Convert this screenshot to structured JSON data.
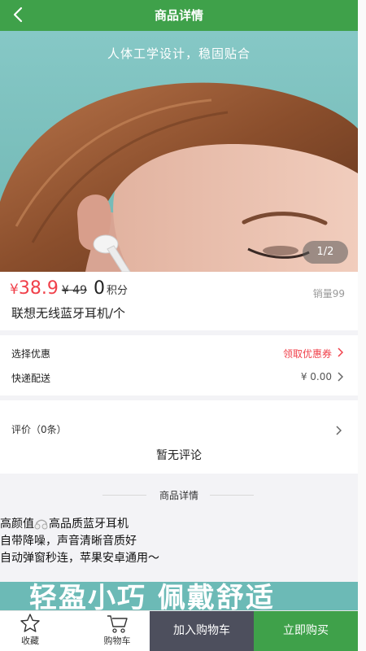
{
  "header": {
    "title": "商品详情",
    "back_icon": "chevron-left-icon"
  },
  "hero": {
    "tagline": "人体工学设计，稳固贴合",
    "pager": "1/2"
  },
  "product": {
    "currency": "¥",
    "price": "38.9",
    "old_price": "¥ 49",
    "points": "0",
    "points_unit": "积分",
    "sales_label": "销量",
    "sales_count": "99",
    "name": "联想无线蓝牙耳机/个"
  },
  "options": {
    "discount": {
      "label": "选择优惠",
      "value": "领取优惠券",
      "color": "#f0404a"
    },
    "shipping": {
      "label": "快递配送",
      "value": "¥ 0.00",
      "color": "#555555"
    }
  },
  "reviews": {
    "label": "评价（0条）",
    "empty_text": "暂无评论"
  },
  "details": {
    "heading": "商品详情",
    "lines": [
      {
        "before": "高颜值",
        "after": "高品质蓝牙耳机"
      },
      {
        "text": "自带降噪，声音清晰音质好"
      },
      {
        "text": "自动弹窗秒连，苹果安卓通用～"
      }
    ],
    "banner_text": "轻盈小巧 佩戴舒适"
  },
  "tabbar": {
    "favorite": {
      "label": "收藏",
      "icon": "star-icon"
    },
    "cart": {
      "label": "购物车",
      "icon": "cart-icon"
    },
    "add_to_cart": "加入购物车",
    "buy_now": "立即购买"
  },
  "colors": {
    "brand_green": "#3fa14a",
    "price_red": "#f0404a",
    "dark_button": "#4d4f5d"
  }
}
